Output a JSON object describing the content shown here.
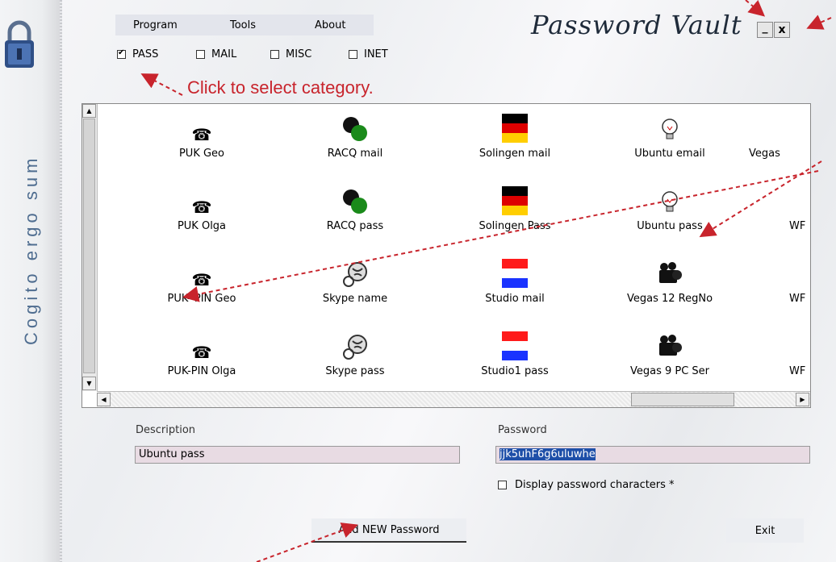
{
  "app": {
    "title": "Password Vault",
    "motto": "Cogito ergo sum"
  },
  "menu": {
    "items": [
      {
        "label": "Program"
      },
      {
        "label": "Tools"
      },
      {
        "label": "About"
      }
    ]
  },
  "categories": [
    {
      "label": "PASS",
      "checked": true
    },
    {
      "label": "MAIL",
      "checked": false
    },
    {
      "label": "MISC",
      "checked": false
    },
    {
      "label": "INET",
      "checked": false
    }
  ],
  "hint": "Click to select category.",
  "window_buttons": {
    "minimize": "_",
    "close": "x"
  },
  "list": {
    "columns": [
      {
        "icon": "telephone-icon",
        "items": [
          "PUK Geo",
          "PUK Olga",
          "PUK- PIN Geo",
          "PUK-PIN Olga"
        ]
      },
      {
        "icon": "green-black-dots-icon",
        "items": [
          "RACQ mail",
          "RACQ pass",
          "Skype name",
          "Skype pass"
        ]
      },
      {
        "icon": "flag-icon",
        "items": [
          "Solingen mail",
          "Solingen Pass",
          "Studio mail",
          "Studio1 pass"
        ]
      },
      {
        "icon": "lightbulb-icon",
        "items": [
          "Ubuntu email",
          "Ubuntu pass",
          "Vegas 12 RegNo",
          "Vegas 9 PC Ser"
        ]
      },
      {
        "icon": "",
        "items": [
          "Vegas",
          "WF",
          "WF",
          "WF"
        ]
      }
    ]
  },
  "form": {
    "description_label": "Description",
    "description_value": "Ubuntu pass",
    "password_label": "Password",
    "password_value": "jjk5uhF6g6uluwhe",
    "display_chars_label": "Display password characters *"
  },
  "buttons": {
    "add_new": "Add NEW Password",
    "exit": "Exit"
  },
  "colors": {
    "accent_red": "#c8242c",
    "motto_blue": "#4f6d90",
    "selection_blue": "#1e4fa8",
    "field_bg": "#e8dbe3"
  }
}
